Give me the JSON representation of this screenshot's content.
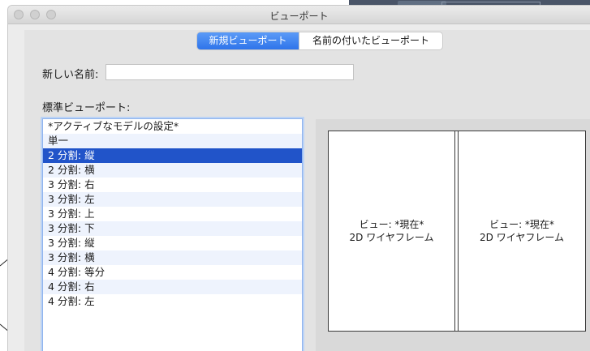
{
  "window": {
    "title": "ビューポート"
  },
  "tabs": [
    {
      "label": "新規ビューポート",
      "active": true
    },
    {
      "label": "名前の付いたビューポート",
      "active": false
    }
  ],
  "form": {
    "new_name_label": "新しい名前:",
    "new_name_value": "",
    "standard_label": "標準ビューポート:"
  },
  "standard_viewports": [
    "*アクティブなモデルの設定*",
    "単一",
    "2 分割: 縦",
    "2 分割: 横",
    "3 分割: 右",
    "3 分割: 左",
    "3 分割: 上",
    "3 分割: 下",
    "3 分割: 縦",
    "3 分割: 横",
    "4 分割: 等分",
    "4 分割: 右",
    "4 分割: 左"
  ],
  "selected_index": 2,
  "preview": {
    "viewports": [
      {
        "view": "ビュー: *現在*",
        "style": "2D ワイヤフレーム"
      },
      {
        "view": "ビュー: *現在*",
        "style": "2D ワイヤフレーム"
      }
    ]
  },
  "colors": {
    "selection": "#2154c9",
    "accent": "#2f74ea"
  }
}
